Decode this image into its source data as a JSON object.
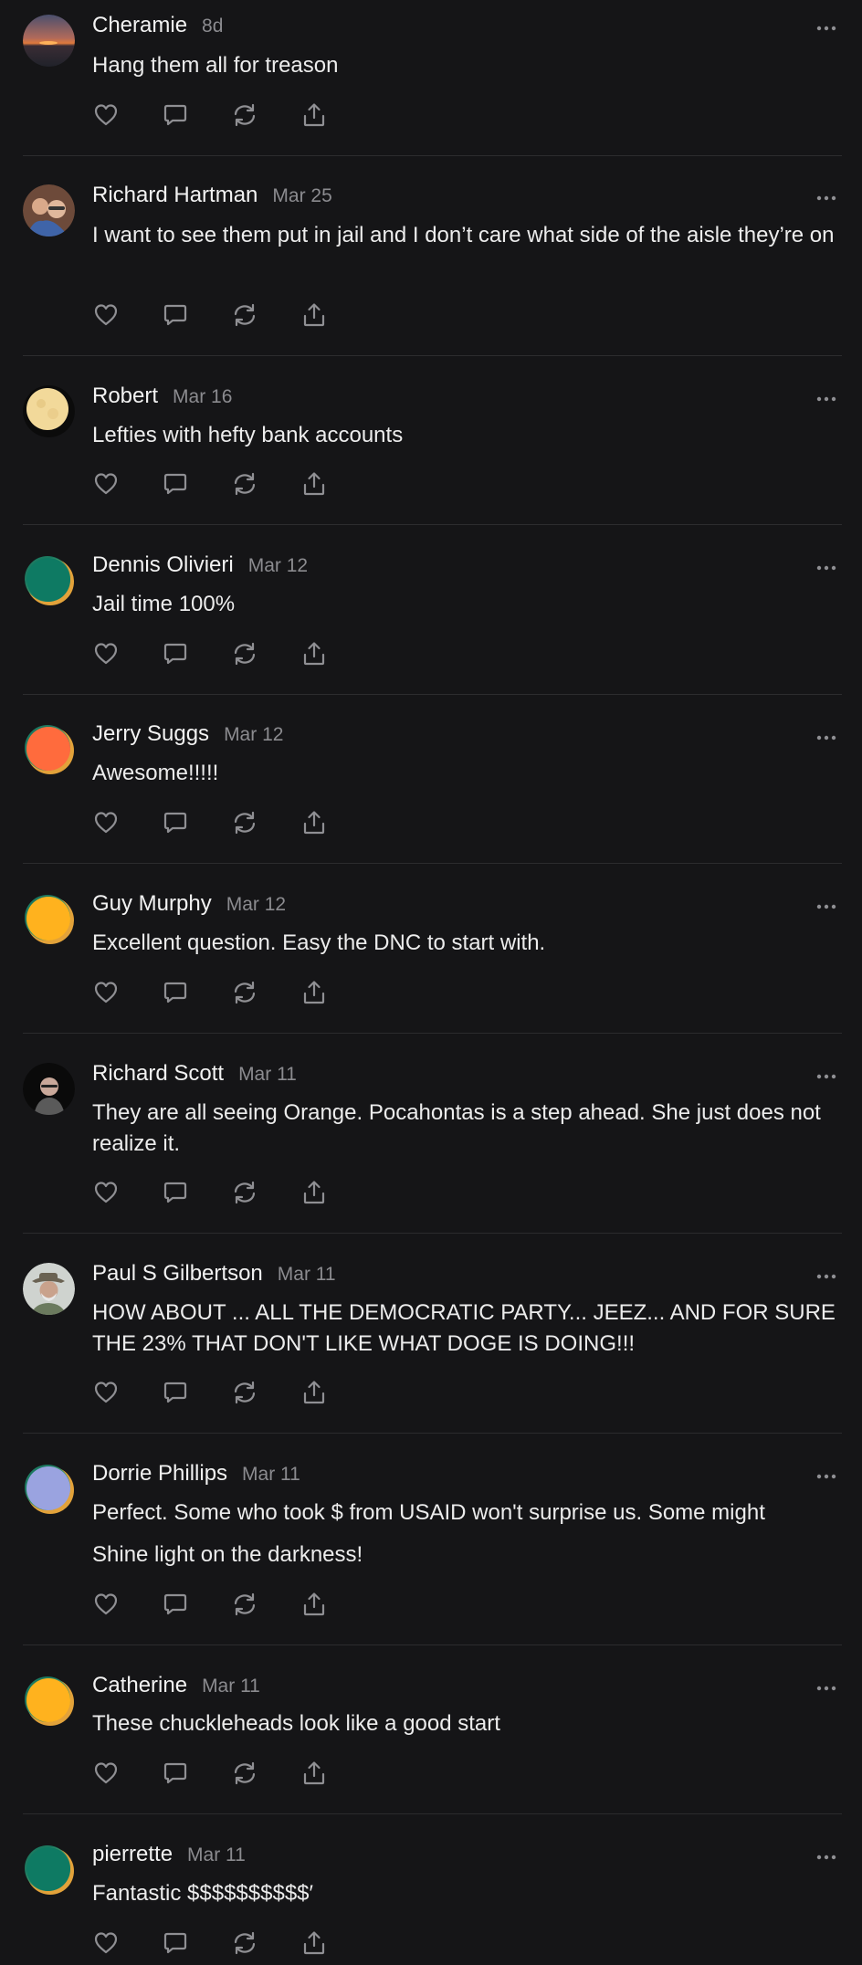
{
  "posts": [
    {
      "name": "Cheramie",
      "date": "8d",
      "avatar": "sunset-photo-avatar-icon",
      "lines": [
        "Hang them all for treason"
      ]
    },
    {
      "name": "Richard Hartman",
      "date": "Mar 25",
      "avatar": "couple-photo-avatar-icon",
      "lines": [
        "I want to see them put in jail and I don’t care what side of the aisle they’re on"
      ]
    },
    {
      "name": "Robert",
      "date": "Mar 16",
      "avatar": "moon-photo-avatar-icon",
      "lines": [
        "Lefties with hefty bank accounts"
      ]
    },
    {
      "name": "Dennis Olivieri",
      "date": "Mar 12",
      "avatar": "default-avatar-icon",
      "avatar_color": "#0e7a63",
      "lines": [
        "Jail time 100%"
      ]
    },
    {
      "name": "Jerry Suggs",
      "date": "Mar 12",
      "avatar": "default-avatar-icon",
      "avatar_color": "#ff6b3d",
      "lines": [
        "Awesome!!!!!"
      ]
    },
    {
      "name": "Guy Murphy",
      "date": "Mar 12",
      "avatar": "default-avatar-icon",
      "avatar_color": "#ffb21e",
      "lines": [
        "Excellent question. Easy the DNC to start with."
      ]
    },
    {
      "name": "Richard Scott",
      "date": "Mar 11",
      "avatar": "man-photo-avatar-icon",
      "lines": [
        "They are all seeing Orange. Pocahontas is a step ahead. She just does not realize it."
      ]
    },
    {
      "name": "Paul S Gilbertson",
      "date": "Mar 11",
      "avatar": "man-hat-photo-avatar-icon",
      "lines": [
        "HOW ABOUT ... ALL THE DEMOCRATIC PARTY... JEEZ... AND FOR SURE THE 23% THAT DON'T LIKE WHAT DOGE IS DOING!!!"
      ]
    },
    {
      "name": "Dorrie Phillips",
      "date": "Mar 11",
      "avatar": "default-avatar-icon",
      "avatar_color": "#9aa3e0",
      "lines": [
        "Perfect. Some who took $ from USAID won't surprise us. Some might",
        "Shine light on the darkness!"
      ]
    },
    {
      "name": "Catherine",
      "date": "Mar 11",
      "avatar": "default-avatar-icon",
      "avatar_color": "#ffb21e",
      "lines": [
        "These chuckleheads look like a good start"
      ]
    },
    {
      "name": "pierrette",
      "date": "Mar 11",
      "avatar": "default-avatar-icon",
      "avatar_color": "#0e7a63",
      "lines": [
        "Fantastic $$$$$$$$$$′"
      ]
    }
  ],
  "actions": [
    "heart-icon",
    "comment-icon",
    "restack-icon",
    "share-icon"
  ],
  "colors": {
    "background": "#151517",
    "text": "#ececec",
    "muted": "#8b8b8f",
    "divider": "#2c2c2e"
  }
}
